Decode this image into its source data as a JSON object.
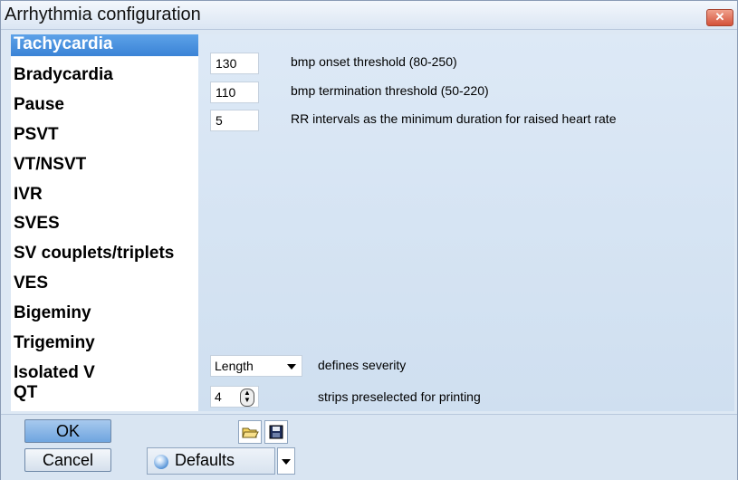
{
  "window": {
    "title": "Arrhythmia configuration"
  },
  "sidebar": {
    "items": [
      {
        "label": "Tachycardia",
        "selected": true
      },
      {
        "label": "Bradycardia"
      },
      {
        "label": "Pause"
      },
      {
        "label": "PSVT"
      },
      {
        "label": "VT/NSVT"
      },
      {
        "label": "IVR"
      },
      {
        "label": "SVES"
      },
      {
        "label": "SV couplets/triplets"
      },
      {
        "label": "VES"
      },
      {
        "label": "Bigeminy"
      },
      {
        "label": "Trigeminy"
      },
      {
        "label": "Isolated V"
      },
      {
        "label": "QT"
      }
    ]
  },
  "settings": {
    "onset": {
      "value": "130",
      "label": "bmp onset threshold (80-250)"
    },
    "termination": {
      "value": "110",
      "label": "bmp termination threshold (50-220)"
    },
    "rr": {
      "value": "5",
      "label": "RR intervals as the minimum duration for raised heart rate"
    },
    "severity": {
      "value": "Length",
      "label": "defines severity"
    },
    "strips": {
      "value": "4",
      "label": "strips preselected for printing"
    }
  },
  "footer": {
    "ok_label": "OK",
    "cancel_label": "Cancel",
    "defaults_label": "Defaults"
  },
  "colors": {
    "selected_bg": "#3a83d6",
    "close_button": "#d4523a"
  },
  "icons": [
    "close-icon",
    "open-folder-icon",
    "save-icon",
    "defaults-icon",
    "chevron-down-icon",
    "spin-up-down-icon"
  ]
}
